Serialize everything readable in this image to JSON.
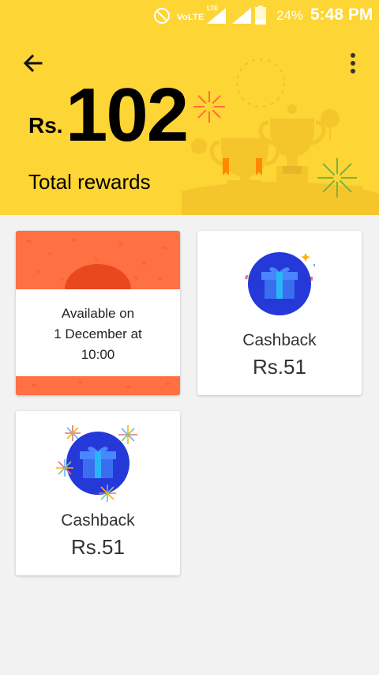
{
  "status_bar": {
    "network_label": "VoLTE",
    "lte_label": "LTE",
    "battery_percent": "24%",
    "time": "5:48 PM",
    "icons": [
      "do-not-disturb-icon",
      "signal-icon",
      "signal-icon",
      "battery-icon"
    ]
  },
  "header": {
    "back_icon": "arrow-back-icon",
    "menu_icon": "more-vert-icon",
    "currency": "Rs.",
    "amount": "102",
    "label": "Total rewards"
  },
  "cards": [
    {
      "type": "locked",
      "line1": "Available on",
      "line2": "1 December at",
      "line3": "10:00"
    },
    {
      "type": "cashback",
      "icon": "gift-icon",
      "title": "Cashback",
      "value": "Rs.51"
    },
    {
      "type": "cashback",
      "icon": "gift-icon",
      "title": "Cashback",
      "value": "Rs.51"
    }
  ],
  "colors": {
    "header_bg": "#fdd535",
    "locked_card": "#ff7043",
    "gift_circle": "#2538d8",
    "page_bg": "#f2f2f2"
  }
}
